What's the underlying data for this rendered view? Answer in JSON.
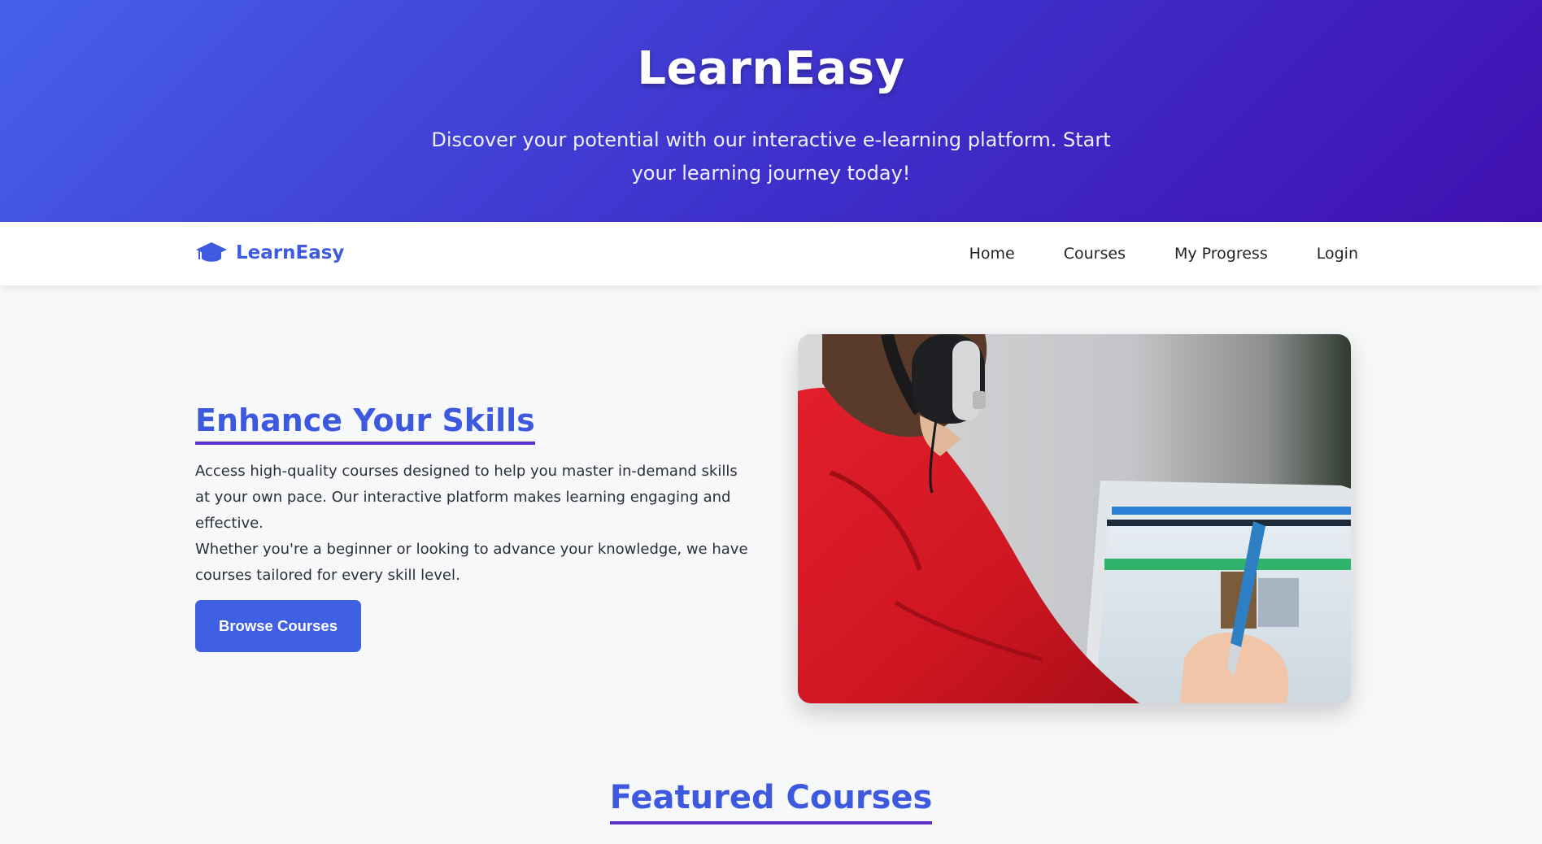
{
  "hero": {
    "title": "LearnEasy",
    "subtitle": "Discover your potential with our interactive e-learning platform. Start your learning journey today!"
  },
  "navbar": {
    "brand_icon": "graduation-cap-icon",
    "brand_name": "LearnEasy",
    "links": [
      {
        "label": "Home"
      },
      {
        "label": "Courses"
      },
      {
        "label": "My Progress"
      },
      {
        "label": "Login"
      }
    ]
  },
  "feature": {
    "heading": "Enhance Your Skills",
    "paragraph_1": "Access high-quality courses designed to help you master in-demand skills at your own pace. Our interactive platform makes learning engaging and effective.",
    "paragraph_2": "Whether you're a beginner or looking to advance your knowledge, we have courses tailored for every skill level.",
    "button_label": "Browse Courses"
  },
  "featured_courses": {
    "title": "Featured Courses"
  },
  "colors": {
    "primary": "#4060e4",
    "hero_gradient_start": "#4660ea",
    "hero_gradient_end": "#4110b0",
    "heading_underline": "#5b30c8"
  }
}
